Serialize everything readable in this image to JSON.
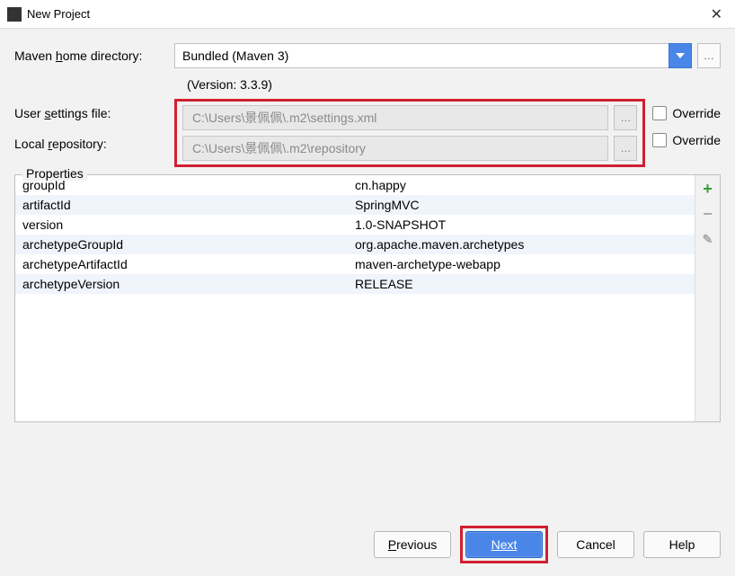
{
  "titlebar": {
    "title": "New Project"
  },
  "form": {
    "mavenHome": {
      "label": "Maven home directory:",
      "value": "Bundled (Maven 3)",
      "version": "(Version: 3.3.9)"
    },
    "settingsFile": {
      "label": "User settings file:",
      "value": "C:\\Users\\景佩佩\\.m2\\settings.xml",
      "overrideLabel": "Override"
    },
    "localRepo": {
      "label": "Local repository:",
      "value": "C:\\Users\\景佩佩\\.m2\\repository",
      "overrideLabel": "Override"
    }
  },
  "properties": {
    "legend": "Properties",
    "rows": [
      {
        "key": "groupId",
        "value": "cn.happy"
      },
      {
        "key": "artifactId",
        "value": "SpringMVC"
      },
      {
        "key": "version",
        "value": "1.0-SNAPSHOT"
      },
      {
        "key": "archetypeGroupId",
        "value": "org.apache.maven.archetypes"
      },
      {
        "key": "archetypeArtifactId",
        "value": "maven-archetype-webapp"
      },
      {
        "key": "archetypeVersion",
        "value": "RELEASE"
      }
    ]
  },
  "buttons": {
    "previous": "Previous",
    "next": "Next",
    "cancel": "Cancel",
    "help": "Help"
  }
}
